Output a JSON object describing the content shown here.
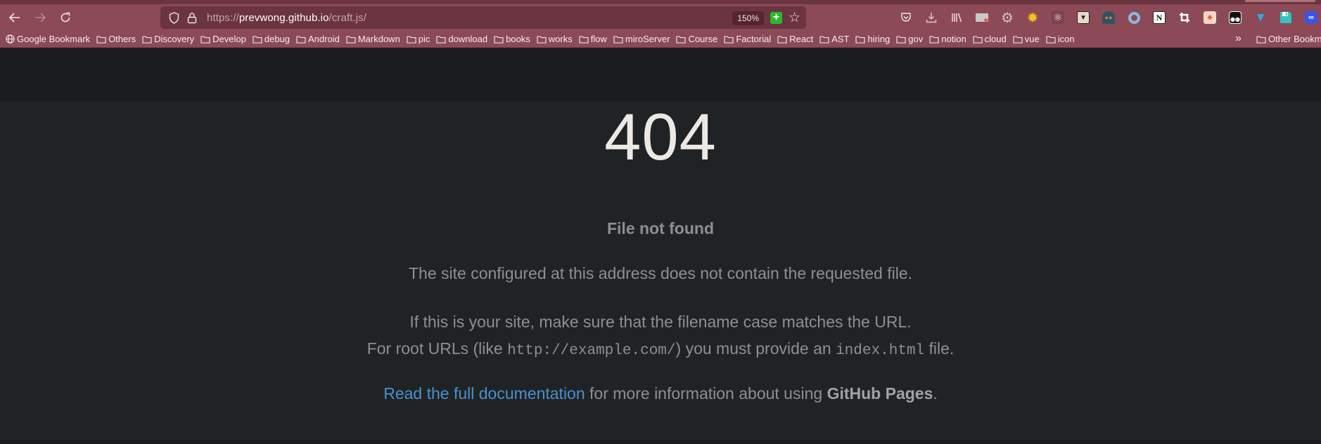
{
  "browser": {
    "nav": {
      "back": "←",
      "forward": "→",
      "reload": "↻"
    },
    "url": {
      "scheme": "https://",
      "host": "prevwong.github.io",
      "path": "/craft.js/"
    },
    "zoom_level": "150%",
    "extensions": [
      {
        "name": "pocket-icon"
      },
      {
        "name": "downloads-icon"
      },
      {
        "name": "library-icon"
      },
      {
        "name": "extension-tab-icon"
      },
      {
        "name": "gear-extension-icon"
      },
      {
        "name": "sun-extension-icon"
      },
      {
        "name": "react-devtools-icon"
      },
      {
        "name": "bear-extension-icon"
      },
      {
        "name": "spy-extension-icon"
      },
      {
        "name": "ring-extension-icon"
      },
      {
        "name": "notion-icon",
        "glyph": "N"
      },
      {
        "name": "crop-icon"
      },
      {
        "name": "org-chart-extension-icon"
      },
      {
        "name": "tampermonkey-icon"
      },
      {
        "name": "diamond-extension-icon"
      },
      {
        "name": "save-extension-icon"
      },
      {
        "name": "link-extension-icon"
      }
    ],
    "bookmarks": [
      {
        "label": "Google Bookmark",
        "icon": "globe"
      },
      {
        "label": "Others",
        "icon": "folder"
      },
      {
        "label": "Discovery",
        "icon": "folder"
      },
      {
        "label": "Develop",
        "icon": "folder"
      },
      {
        "label": "debug",
        "icon": "folder"
      },
      {
        "label": "Android",
        "icon": "folder"
      },
      {
        "label": "Markdown",
        "icon": "folder"
      },
      {
        "label": "pic",
        "icon": "folder"
      },
      {
        "label": "download",
        "icon": "folder"
      },
      {
        "label": "books",
        "icon": "folder"
      },
      {
        "label": "works",
        "icon": "folder"
      },
      {
        "label": "flow",
        "icon": "folder"
      },
      {
        "label": "miroServer",
        "icon": "folder"
      },
      {
        "label": "Course",
        "icon": "folder"
      },
      {
        "label": "Factorial",
        "icon": "folder"
      },
      {
        "label": "React",
        "icon": "folder"
      },
      {
        "label": "AST",
        "icon": "folder"
      },
      {
        "label": "hiring",
        "icon": "folder"
      },
      {
        "label": "gov",
        "icon": "folder"
      },
      {
        "label": "notion",
        "icon": "folder"
      },
      {
        "label": "cloud",
        "icon": "folder"
      },
      {
        "label": "vue",
        "icon": "folder"
      },
      {
        "label": "icon",
        "icon": "folder"
      }
    ],
    "bookmarks_overflow": "»",
    "other_bookmarks": "Other Bookmarks"
  },
  "page": {
    "code": "404",
    "title": "File not found",
    "p1": "The site configured at this address does not contain the requested file.",
    "p2_line1": "If this is your site, make sure that the filename case matches the URL.",
    "p2_line2_pre": "For root URLs (like ",
    "p2_code1": "http://example.com/",
    "p2_line2_mid": ") you must provide an ",
    "p2_code2": "index.html",
    "p2_line2_post": " file.",
    "p3_link": "Read the full documentation",
    "p3_mid": " for more information about using ",
    "p3_strong": "GitHub Pages",
    "p3_post": "."
  },
  "colors": {
    "chrome": "#8b4a55",
    "link": "#4c8fce",
    "page_bg": "#202325"
  }
}
